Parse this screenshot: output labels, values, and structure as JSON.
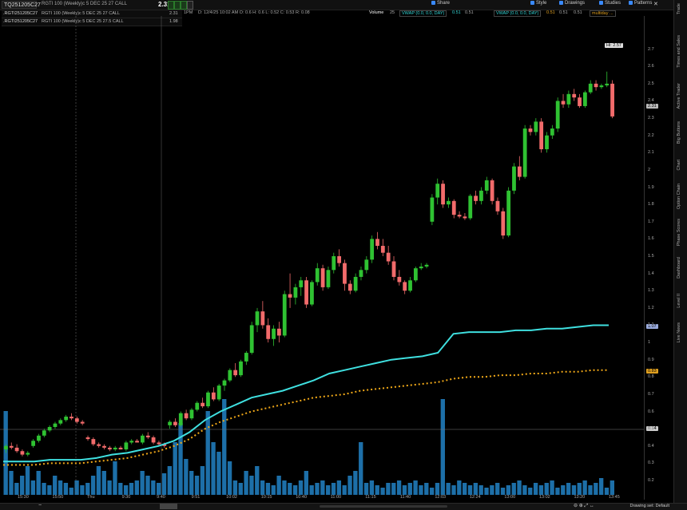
{
  "toolbar": {
    "symbol": "TQ251205C27",
    "description": "RGTI 100 (Weekly)c 5 DEC 25 27 CALL",
    "last_price": "2.31",
    "buttons": [
      {
        "label": "Share",
        "icon": "share-icon"
      },
      {
        "label": "Style",
        "icon": "style-icon"
      },
      {
        "label": "Drawings",
        "icon": "pencil-icon"
      },
      {
        "label": "Studies",
        "icon": "flask-icon"
      },
      {
        "label": "Patterns",
        "icon": "pattern-icon"
      }
    ]
  },
  "legend": {
    "ohlc": "D: 12/4/25 10:02 AM  O: 0.6  H: 0.6  L: 0.52  C: 0.53  R: 0.08",
    "ohlc_prefix": "1PM",
    "volume_label": "Volume",
    "volume_value": "25",
    "vwap1": "VWAP (0.0, 0.0, DAY)",
    "vwap1_value": "0.51",
    "vwap1_extra": "0.51",
    "vwap2": "VWAP (0.0, 0.0, DAY)",
    "vwap2_value": "0.51",
    "vwap2_extra1": "0.51",
    "vwap2_extra2": "0.51",
    "multiday": "multiday ..."
  },
  "contracts": [
    {
      "symbol": ".RGTI251205C27",
      "desc": "RGTI 100 (Weekly)c 5 DEC 25 27 CALL",
      "value": "2.31"
    },
    {
      "symbol": ".RGTI251205C27",
      "desc": "RGTI 100 (Weekly)c 5 DEC 25 27.5 CALL",
      "value": "1.98"
    }
  ],
  "sidebar_tabs": [
    "Trade",
    "Times and Sales",
    "Active Trader",
    "Big Buttons",
    "Chart",
    "Option Chain",
    "Phase Scores",
    "Dashboard",
    "Level II",
    "Live News"
  ],
  "price_badges": {
    "high": "Hi: 2.57",
    "last": "2.31",
    "vwap_upper": "1.07",
    "vwap_lower": "0.83",
    "crosshair": "0.54"
  },
  "bottom": {
    "drawing_set": "Drawing set: Default"
  },
  "chart_data": {
    "type": "candlestick",
    "y_ticks": [
      2.7,
      2.6,
      2.5,
      2.4,
      2.3,
      2.2,
      2.1,
      2,
      1.9,
      1.8,
      1.7,
      1.6,
      1.5,
      1.4,
      1.3,
      1.2,
      1.1,
      1,
      0.9,
      0.8,
      0.7,
      0.6,
      0.5,
      0.4,
      0.3,
      0.2
    ],
    "ylim": [
      0.2,
      2.8
    ],
    "x_labels": [
      "15:30",
      "15:50",
      "Thu",
      "9:30",
      "9:40",
      "9:51",
      "10:02",
      "10:15",
      "10:40",
      "11:00",
      "11:15",
      "11:40",
      "12:03",
      "12:24",
      "13:00",
      "13:02",
      "13:20",
      "13:45"
    ],
    "candles": [
      {
        "o": 0.38,
        "h": 0.41,
        "l": 0.36,
        "c": 0.4
      },
      {
        "o": 0.4,
        "h": 0.42,
        "l": 0.38,
        "c": 0.39
      },
      {
        "o": 0.39,
        "h": 0.41,
        "l": 0.36,
        "c": 0.37
      },
      {
        "o": 0.37,
        "h": 0.38,
        "l": 0.34,
        "c": 0.35
      },
      {
        "o": 0.35,
        "h": 0.37,
        "l": 0.34,
        "c": 0.36
      },
      {
        "o": 0.4,
        "h": 0.44,
        "l": 0.39,
        "c": 0.43
      },
      {
        "o": 0.43,
        "h": 0.47,
        "l": 0.42,
        "c": 0.46
      },
      {
        "o": 0.46,
        "h": 0.5,
        "l": 0.45,
        "c": 0.49
      },
      {
        "o": 0.49,
        "h": 0.52,
        "l": 0.48,
        "c": 0.51
      },
      {
        "o": 0.51,
        "h": 0.54,
        "l": 0.5,
        "c": 0.53
      },
      {
        "o": 0.53,
        "h": 0.56,
        "l": 0.52,
        "c": 0.55
      },
      {
        "o": 0.55,
        "h": 0.58,
        "l": 0.54,
        "c": 0.57
      },
      {
        "o": 0.57,
        "h": 0.59,
        "l": 0.55,
        "c": 0.56
      },
      {
        "o": 0.56,
        "h": 0.57,
        "l": 0.53,
        "c": 0.54
      },
      {
        "o": 0.54,
        "h": 0.55,
        "l": 0.52,
        "c": 0.53
      },
      {
        "o": 0.45,
        "h": 0.46,
        "l": 0.43,
        "c": 0.44
      },
      {
        "o": 0.44,
        "h": 0.45,
        "l": 0.4,
        "c": 0.41
      },
      {
        "o": 0.41,
        "h": 0.42,
        "l": 0.39,
        "c": 0.4
      },
      {
        "o": 0.4,
        "h": 0.41,
        "l": 0.38,
        "c": 0.39
      },
      {
        "o": 0.39,
        "h": 0.4,
        "l": 0.37,
        "c": 0.38
      },
      {
        "o": 0.38,
        "h": 0.4,
        "l": 0.37,
        "c": 0.39
      },
      {
        "o": 0.39,
        "h": 0.4,
        "l": 0.38,
        "c": 0.38
      },
      {
        "o": 0.38,
        "h": 0.43,
        "l": 0.37,
        "c": 0.42
      },
      {
        "o": 0.42,
        "h": 0.44,
        "l": 0.41,
        "c": 0.43
      },
      {
        "o": 0.43,
        "h": 0.44,
        "l": 0.42,
        "c": 0.42
      },
      {
        "o": 0.42,
        "h": 0.47,
        "l": 0.41,
        "c": 0.46
      },
      {
        "o": 0.46,
        "h": 0.48,
        "l": 0.44,
        "c": 0.45
      },
      {
        "o": 0.45,
        "h": 0.46,
        "l": 0.41,
        "c": 0.42
      },
      {
        "o": 0.42,
        "h": 0.43,
        "l": 0.4,
        "c": 0.41
      },
      {
        "o": 0.41,
        "h": 0.42,
        "l": 0.39,
        "c": 0.4
      },
      {
        "o": 0.52,
        "h": 0.55,
        "l": 0.5,
        "c": 0.54
      },
      {
        "o": 0.54,
        "h": 0.56,
        "l": 0.51,
        "c": 0.52
      },
      {
        "o": 0.52,
        "h": 0.6,
        "l": 0.51,
        "c": 0.59
      },
      {
        "o": 0.59,
        "h": 0.61,
        "l": 0.55,
        "c": 0.56
      },
      {
        "o": 0.56,
        "h": 0.62,
        "l": 0.55,
        "c": 0.61
      },
      {
        "o": 0.61,
        "h": 0.66,
        "l": 0.6,
        "c": 0.65
      },
      {
        "o": 0.65,
        "h": 0.68,
        "l": 0.62,
        "c": 0.63
      },
      {
        "o": 0.63,
        "h": 0.72,
        "l": 0.62,
        "c": 0.71
      },
      {
        "o": 0.71,
        "h": 0.74,
        "l": 0.66,
        "c": 0.67
      },
      {
        "o": 0.67,
        "h": 0.76,
        "l": 0.66,
        "c": 0.75
      },
      {
        "o": 0.75,
        "h": 0.79,
        "l": 0.72,
        "c": 0.78
      },
      {
        "o": 0.78,
        "h": 0.85,
        "l": 0.77,
        "c": 0.84
      },
      {
        "o": 0.84,
        "h": 0.88,
        "l": 0.8,
        "c": 0.81
      },
      {
        "o": 0.81,
        "h": 0.9,
        "l": 0.8,
        "c": 0.89
      },
      {
        "o": 0.89,
        "h": 0.95,
        "l": 0.87,
        "c": 0.94
      },
      {
        "o": 0.94,
        "h": 1.12,
        "l": 0.93,
        "c": 1.1
      },
      {
        "o": 1.1,
        "h": 1.2,
        "l": 1.06,
        "c": 1.18
      },
      {
        "o": 1.18,
        "h": 1.24,
        "l": 1.08,
        "c": 1.1
      },
      {
        "o": 1.1,
        "h": 1.14,
        "l": 1.0,
        "c": 1.02
      },
      {
        "o": 1.02,
        "h": 1.1,
        "l": 0.98,
        "c": 1.08
      },
      {
        "o": 1.08,
        "h": 1.12,
        "l": 1.0,
        "c": 1.04
      },
      {
        "o": 1.04,
        "h": 1.3,
        "l": 1.03,
        "c": 1.28
      },
      {
        "o": 1.28,
        "h": 1.4,
        "l": 1.2,
        "c": 1.26
      },
      {
        "o": 1.26,
        "h": 1.34,
        "l": 1.22,
        "c": 1.32
      },
      {
        "o": 1.32,
        "h": 1.38,
        "l": 1.27,
        "c": 1.36
      },
      {
        "o": 1.36,
        "h": 1.38,
        "l": 1.2,
        "c": 1.22
      },
      {
        "o": 1.22,
        "h": 1.36,
        "l": 1.21,
        "c": 1.35
      },
      {
        "o": 1.35,
        "h": 1.46,
        "l": 1.33,
        "c": 1.43
      },
      {
        "o": 1.43,
        "h": 1.45,
        "l": 1.3,
        "c": 1.32
      },
      {
        "o": 1.32,
        "h": 1.44,
        "l": 1.31,
        "c": 1.42
      },
      {
        "o": 1.42,
        "h": 1.52,
        "l": 1.4,
        "c": 1.5
      },
      {
        "o": 1.5,
        "h": 1.54,
        "l": 1.44,
        "c": 1.46
      },
      {
        "o": 1.46,
        "h": 1.48,
        "l": 1.3,
        "c": 1.34
      },
      {
        "o": 1.34,
        "h": 1.36,
        "l": 1.28,
        "c": 1.3
      },
      {
        "o": 1.3,
        "h": 1.4,
        "l": 1.29,
        "c": 1.38
      },
      {
        "o": 1.38,
        "h": 1.44,
        "l": 1.36,
        "c": 1.42
      },
      {
        "o": 1.42,
        "h": 1.5,
        "l": 1.4,
        "c": 1.48
      },
      {
        "o": 1.48,
        "h": 1.62,
        "l": 1.46,
        "c": 1.6
      },
      {
        "o": 1.6,
        "h": 1.64,
        "l": 1.54,
        "c": 1.56
      },
      {
        "o": 1.56,
        "h": 1.6,
        "l": 1.5,
        "c": 1.52
      },
      {
        "o": 1.52,
        "h": 1.56,
        "l": 1.45,
        "c": 1.47
      },
      {
        "o": 1.47,
        "h": 1.5,
        "l": 1.36,
        "c": 1.38
      },
      {
        "o": 1.38,
        "h": 1.42,
        "l": 1.33,
        "c": 1.35
      },
      {
        "o": 1.35,
        "h": 1.36,
        "l": 1.28,
        "c": 1.3
      },
      {
        "o": 1.3,
        "h": 1.38,
        "l": 1.29,
        "c": 1.36
      },
      {
        "o": 1.36,
        "h": 1.44,
        "l": 1.35,
        "c": 1.43
      },
      {
        "o": 1.43,
        "h": 1.46,
        "l": 1.42,
        "c": 1.44
      },
      {
        "o": 1.44,
        "h": 1.46,
        "l": 1.43,
        "c": 1.45
      },
      {
        "o": 1.7,
        "h": 1.86,
        "l": 1.68,
        "c": 1.84
      },
      {
        "o": 1.84,
        "h": 1.95,
        "l": 1.8,
        "c": 1.92
      },
      {
        "o": 1.92,
        "h": 1.94,
        "l": 1.78,
        "c": 1.8
      },
      {
        "o": 1.8,
        "h": 1.84,
        "l": 1.78,
        "c": 1.82
      },
      {
        "o": 1.82,
        "h": 1.83,
        "l": 1.72,
        "c": 1.74
      },
      {
        "o": 1.74,
        "h": 1.76,
        "l": 1.72,
        "c": 1.73
      },
      {
        "o": 1.73,
        "h": 1.75,
        "l": 1.71,
        "c": 1.72
      },
      {
        "o": 1.72,
        "h": 1.86,
        "l": 1.71,
        "c": 1.85
      },
      {
        "o": 1.85,
        "h": 1.88,
        "l": 1.8,
        "c": 1.82
      },
      {
        "o": 1.82,
        "h": 1.9,
        "l": 1.8,
        "c": 1.88
      },
      {
        "o": 1.88,
        "h": 1.96,
        "l": 1.86,
        "c": 1.94
      },
      {
        "o": 1.94,
        "h": 1.95,
        "l": 1.8,
        "c": 1.82
      },
      {
        "o": 1.82,
        "h": 1.84,
        "l": 1.74,
        "c": 1.76
      },
      {
        "o": 1.76,
        "h": 1.78,
        "l": 1.6,
        "c": 1.62
      },
      {
        "o": 1.62,
        "h": 1.9,
        "l": 1.61,
        "c": 1.88
      },
      {
        "o": 1.88,
        "h": 2.04,
        "l": 1.86,
        "c": 2.02
      },
      {
        "o": 2.02,
        "h": 2.08,
        "l": 1.94,
        "c": 1.96
      },
      {
        "o": 1.96,
        "h": 2.26,
        "l": 1.95,
        "c": 2.24
      },
      {
        "o": 2.24,
        "h": 2.26,
        "l": 2.2,
        "c": 2.22
      },
      {
        "o": 2.22,
        "h": 2.3,
        "l": 2.2,
        "c": 2.28
      },
      {
        "o": 2.28,
        "h": 2.3,
        "l": 2.1,
        "c": 2.12
      },
      {
        "o": 2.12,
        "h": 2.22,
        "l": 2.1,
        "c": 2.2
      },
      {
        "o": 2.2,
        "h": 2.26,
        "l": 2.18,
        "c": 2.24
      },
      {
        "o": 2.24,
        "h": 2.42,
        "l": 2.22,
        "c": 2.4
      },
      {
        "o": 2.4,
        "h": 2.44,
        "l": 2.36,
        "c": 2.38
      },
      {
        "o": 2.38,
        "h": 2.46,
        "l": 2.36,
        "c": 2.44
      },
      {
        "o": 2.44,
        "h": 2.47,
        "l": 2.4,
        "c": 2.42
      },
      {
        "o": 2.42,
        "h": 2.44,
        "l": 2.36,
        "c": 2.37
      },
      {
        "o": 2.37,
        "h": 2.46,
        "l": 2.36,
        "c": 2.45
      },
      {
        "o": 2.45,
        "h": 2.52,
        "l": 2.44,
        "c": 2.5
      },
      {
        "o": 2.5,
        "h": 2.52,
        "l": 2.46,
        "c": 2.48
      },
      {
        "o": 2.48,
        "h": 2.5,
        "l": 2.47,
        "c": 2.49
      },
      {
        "o": 2.49,
        "h": 2.57,
        "l": 2.48,
        "c": 2.5
      },
      {
        "o": 2.5,
        "h": 2.52,
        "l": 2.3,
        "c": 2.31
      }
    ],
    "vwap_upper": [
      0.31,
      0.31,
      0.31,
      0.32,
      0.32,
      0.32,
      0.33,
      0.35,
      0.36,
      0.38,
      0.4,
      0.43,
      0.48,
      0.55,
      0.6,
      0.64,
      0.68,
      0.7,
      0.72,
      0.75,
      0.78,
      0.82,
      0.84,
      0.86,
      0.88,
      0.9,
      0.91,
      0.92,
      0.94,
      1.05,
      1.06,
      1.06,
      1.06,
      1.07,
      1.07,
      1.08,
      1.08,
      1.09,
      1.1,
      1.1
    ],
    "vwap_lower": [
      0.29,
      0.29,
      0.29,
      0.3,
      0.3,
      0.3,
      0.31,
      0.32,
      0.33,
      0.35,
      0.37,
      0.4,
      0.44,
      0.5,
      0.54,
      0.57,
      0.6,
      0.62,
      0.64,
      0.66,
      0.68,
      0.69,
      0.7,
      0.72,
      0.73,
      0.74,
      0.75,
      0.76,
      0.77,
      0.79,
      0.8,
      0.8,
      0.81,
      0.81,
      0.82,
      0.82,
      0.83,
      0.83,
      0.84,
      0.84
    ],
    "volume": [
      0.35,
      0.1,
      0.05,
      0.08,
      0.12,
      0.06,
      0.1,
      0.05,
      0.04,
      0.08,
      0.06,
      0.05,
      0.03,
      0.06,
      0.04,
      0.05,
      0.08,
      0.12,
      0.1,
      0.06,
      0.14,
      0.05,
      0.04,
      0.05,
      0.06,
      0.1,
      0.08,
      0.06,
      0.05,
      0.09,
      0.12,
      0.22,
      0.3,
      0.15,
      0.1,
      0.08,
      0.12,
      0.35,
      0.22,
      0.18,
      0.4,
      0.14,
      0.06,
      0.05,
      0.1,
      0.08,
      0.12,
      0.06,
      0.05,
      0.04,
      0.08,
      0.06,
      0.05,
      0.04,
      0.06,
      0.1,
      0.04,
      0.05,
      0.06,
      0.04,
      0.05,
      0.06,
      0.04,
      0.08,
      0.1,
      0.22,
      0.05,
      0.06,
      0.04,
      0.03,
      0.05,
      0.05,
      0.06,
      0.04,
      0.05,
      0.06,
      0.04,
      0.05,
      0.03,
      0.05,
      0.4,
      0.05,
      0.04,
      0.06,
      0.05,
      0.04,
      0.05,
      0.04,
      0.03,
      0.04,
      0.05,
      0.03,
      0.04,
      0.05,
      0.06,
      0.04,
      0.03,
      0.05,
      0.04,
      0.05,
      0.06,
      0.03,
      0.04,
      0.05,
      0.04,
      0.05,
      0.06,
      0.04,
      0.05,
      0.07,
      0.03,
      0.06
    ],
    "colors": {
      "up": "#2fc232",
      "down": "#f26b6b",
      "vwap_upper": "#3fe0e0",
      "vwap_lower": "#f0a818",
      "volume": "#1d6fa8"
    }
  }
}
